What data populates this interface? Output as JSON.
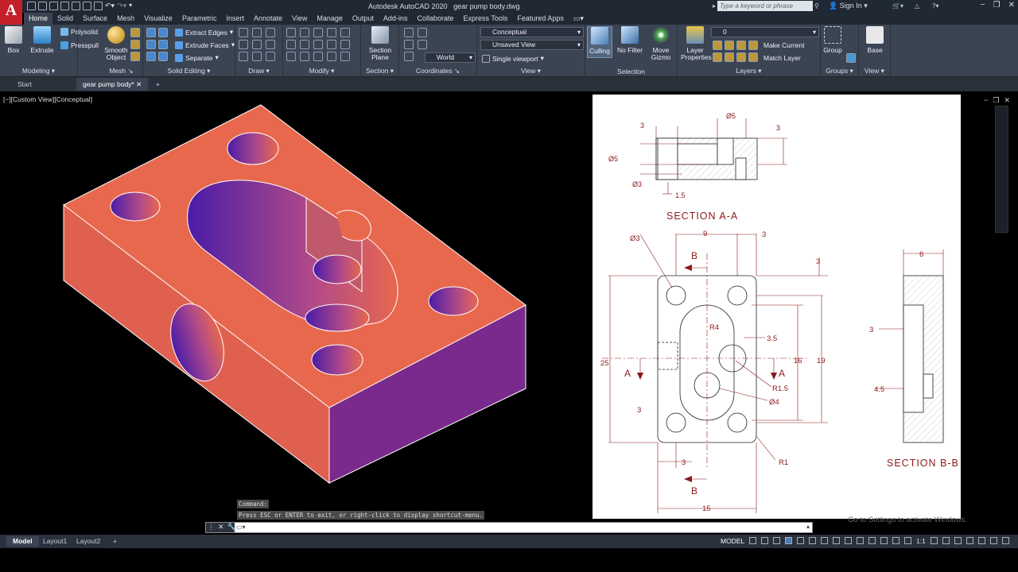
{
  "app": {
    "logo": "A",
    "title": "Autodesk AutoCAD 2020",
    "file": "gear pump body.dwg",
    "search_placeholder": "Type a keyword or phrase",
    "sign_in": "Sign In"
  },
  "ribbon_tabs": [
    "Home",
    "Solid",
    "Surface",
    "Mesh",
    "Visualize",
    "Parametric",
    "Insert",
    "Annotate",
    "View",
    "Manage",
    "Output",
    "Add-ins",
    "Collaborate",
    "Express Tools",
    "Featured Apps"
  ],
  "ribbon": {
    "modeling": {
      "label": "Modeling",
      "box": "Box",
      "extrude": "Extrude",
      "polysolid": "Polysolid",
      "presspull": "Presspull"
    },
    "mesh": {
      "label": "Mesh",
      "smooth": "Smooth Object"
    },
    "solid_editing": {
      "label": "Solid Editing",
      "extract_edges": "Extract Edges",
      "extrude_faces": "Extrude Faces",
      "separate": "Separate"
    },
    "draw": {
      "label": "Draw"
    },
    "modify": {
      "label": "Modify"
    },
    "section": {
      "label": "Section",
      "section_plane": "Section Plane"
    },
    "coordinates": {
      "label": "Coordinates",
      "ucs": "World"
    },
    "view": {
      "label": "View",
      "visual_style": "Conceptual",
      "named_view": "Unsaved View",
      "viewport": "Single viewport"
    },
    "selection": {
      "label": "Selection",
      "culling": "Culling",
      "no_filter": "No Filter",
      "move_gizmo": "Move Gizmo"
    },
    "layers": {
      "label": "Layers",
      "layer_properties": "Layer Properties",
      "layer_value": "0",
      "make_current": "Make Current",
      "match_layer": "Match Layer"
    },
    "groups": {
      "label": "Groups",
      "group": "Group"
    },
    "view2": {
      "label": "View",
      "base": "Base"
    }
  },
  "file_tabs": {
    "start": "Start",
    "active": "gear pump body*"
  },
  "viewport": {
    "label": "[−][Custom View][Conceptual]"
  },
  "drawing": {
    "section_a": "SECTION A-A",
    "section_b": "SECTION B-B",
    "dims_a": [
      "3",
      "Ø5",
      "3",
      "Ø5",
      "Ø3",
      "1.5"
    ],
    "dims_main": [
      "Ø3",
      "9",
      "3",
      "B",
      "3",
      "R4",
      "3.5",
      "25",
      "16",
      "19",
      "A",
      "A",
      "R1.5",
      "Ø4",
      "3",
      "3",
      "R1",
      "B",
      "15"
    ],
    "dims_b": [
      "6",
      "3",
      "4.5"
    ]
  },
  "command": {
    "history": [
      "Command:",
      "Press ESC or ENTER to exit, or right-click to display shortcut-menu."
    ],
    "prompt": ""
  },
  "watermark": "Go to Settings to activate Windows.",
  "status": {
    "layouts": [
      "Model",
      "Layout1",
      "Layout2"
    ],
    "model": "MODEL",
    "scale": "1:1"
  },
  "colors": {
    "face_top": "#e8684e",
    "face_side": "#7a2a8c",
    "hole_purple": "#5a22a8",
    "ribbon": "#3b4453",
    "dim_red": "#8b1a1a"
  }
}
